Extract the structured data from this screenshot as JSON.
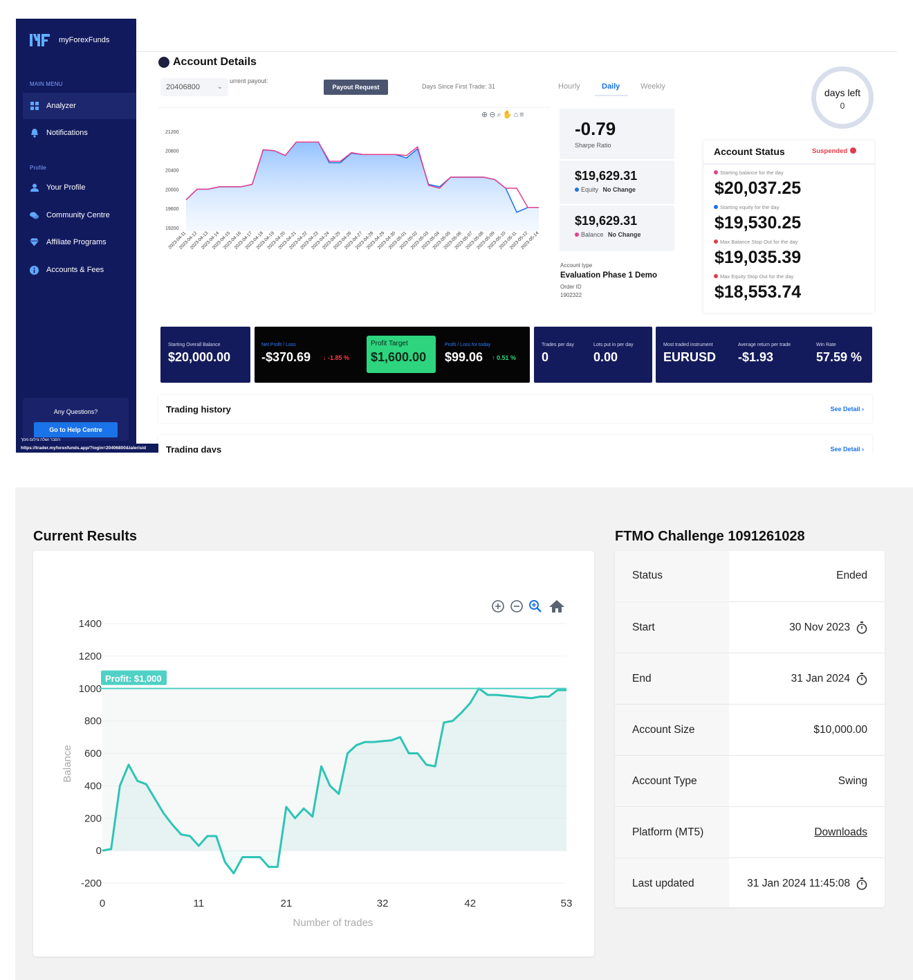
{
  "app": {
    "brand": "myForexFunds",
    "url": "https://trader.myforexfunds.app/?login=20406800&lalerisid"
  },
  "sidebar": {
    "main_menu_heading": "MAIN MENU",
    "profile_heading": "Profile",
    "items": [
      {
        "label": "Analyzer",
        "icon": "grid-icon",
        "active": true
      },
      {
        "label": "Notifications",
        "icon": "bell-icon"
      },
      {
        "label": "Your Profile",
        "icon": "user-icon"
      },
      {
        "label": "Community Centre",
        "icon": "chat-icon"
      },
      {
        "label": "Affiliate Programs",
        "icon": "diamond-icon"
      },
      {
        "label": "Accounts & Fees",
        "icon": "info-icon"
      }
    ],
    "help": {
      "question": "Any Questions?",
      "button": "Go to Help Centre",
      "hebrew": "הסבר ושלה צילום מסך"
    }
  },
  "account": {
    "title": "Account Details",
    "select_value": "20406800",
    "current_payout_label": "urrent payout:",
    "payout_button": "Payout Request",
    "days_since": "Days Since First Trade: 31",
    "tabs": [
      "Hourly",
      "Daily",
      "Weekly"
    ],
    "active_tab": "Daily",
    "days_left_label": "days left",
    "days_left_value": "0",
    "sharpe": {
      "value": "-0.79",
      "label": "Sharpe Ratio"
    },
    "equity": {
      "value": "$19,629.31",
      "label": "Equity",
      "change": "No Change",
      "color": "#1a73e8"
    },
    "balance": {
      "value": "$19,629.31",
      "label": "Balance",
      "change": "No Change",
      "color": "#e83e8c"
    },
    "account_type_label": "Account type",
    "account_type_value": "Evaluation Phase 1 Demo",
    "order_id_label": "Order ID",
    "order_id_value": "1902322"
  },
  "status": {
    "title": "Account Status",
    "badge": "Suspended",
    "items": [
      {
        "label": "Starting balance for the day",
        "value": "$20,037.25",
        "color": "#e83e8c"
      },
      {
        "label": "Starting equity for the day",
        "value": "$19,530.25",
        "color": "#1a73e8"
      },
      {
        "label": "Max Balance Stop Out for the day",
        "value": "$19,035.39",
        "color": "#e23c4b"
      },
      {
        "label": "Max Equity Stop Out for the day",
        "value": "$18,553.74",
        "color": "#e23c4b"
      }
    ]
  },
  "kpis": {
    "starting_balance": {
      "label": "Starting Overall Balance",
      "value": "$20,000.00"
    },
    "net_profit": {
      "label": "Net Profit / Loss",
      "value": "-$370.69",
      "pct": "↓ -1.85 %"
    },
    "profit_target": {
      "label": "Profit Target",
      "value": "$1,600.00"
    },
    "today": {
      "label": "Profit / Loss for today",
      "value": "$99.06",
      "pct": "↑ 0.51 %"
    },
    "trades_per_day": {
      "label": "Trades per day",
      "value": "0"
    },
    "lots_per_day": {
      "label": "Lots put in per day",
      "value": "0.00"
    },
    "instrument": {
      "label": "Most traded instrument",
      "value": "EURUSD"
    },
    "avg_return": {
      "label": "Average return per trade",
      "value": "-$1.93"
    },
    "win_rate": {
      "label": "Win Rate",
      "value": "57.59 %"
    }
  },
  "sections": [
    {
      "title": "Trading history",
      "link": "See Detail ›"
    },
    {
      "title": "Trading days",
      "link": "See Detail ›"
    }
  ],
  "ftmo": {
    "results_title": "Current Results",
    "challenge_title": "FTMO Challenge 1091261028",
    "rows": [
      {
        "key": "Status",
        "value": "Ended"
      },
      {
        "key": "Start",
        "value": "30 Nov 2023",
        "clock": true
      },
      {
        "key": "End",
        "value": "31 Jan 2024",
        "clock": true
      },
      {
        "key": "Account Size",
        "value": "$10,000.00"
      },
      {
        "key": "Account Type",
        "value": "Swing"
      },
      {
        "key": "Platform (MT5)",
        "value": "Downloads",
        "link": true
      },
      {
        "key": "Last updated",
        "value": "31 Jan 2024 11:45:08",
        "clock": true
      }
    ]
  },
  "chart_data": [
    {
      "type": "area",
      "categories": [
        "2023-04-11",
        "2023-04-12",
        "2023-04-13",
        "2023-04-14",
        "2023-04-15",
        "2023-04-16",
        "2023-04-17",
        "2023-04-18",
        "2023-04-19",
        "2023-04-20",
        "2023-04-21",
        "2023-04-22",
        "2023-04-23",
        "2023-04-24",
        "2023-04-25",
        "2023-04-26",
        "2023-04-27",
        "2023-04-28",
        "2023-04-29",
        "2023-04-30",
        "2023-05-01",
        "2023-05-02",
        "2023-05-03",
        "2023-05-04",
        "2023-05-05",
        "2023-05-06",
        "2023-05-07",
        "2023-05-08",
        "2023-05-09",
        "2023-05-10",
        "2023-05-11",
        "2023-05-12",
        "2023-05-14"
      ],
      "series": [
        {
          "name": "Equity",
          "color": "#1a73e8",
          "values": [
            19780,
            20000,
            20000,
            20050,
            20050,
            20050,
            20100,
            20820,
            20800,
            20700,
            20980,
            20980,
            20980,
            20550,
            20550,
            20750,
            20720,
            20720,
            20720,
            20720,
            20650,
            20840,
            20100,
            20050,
            20250,
            20250,
            20250,
            20250,
            20200,
            20020,
            19520,
            19620,
            19620
          ]
        },
        {
          "name": "Balance",
          "color": "#e83e8c",
          "values": [
            19780,
            20000,
            20000,
            20050,
            20050,
            20050,
            20100,
            20820,
            20800,
            20700,
            20980,
            20980,
            20980,
            20580,
            20580,
            20760,
            20720,
            20720,
            20720,
            20720,
            20700,
            20880,
            20080,
            20020,
            20250,
            20250,
            20250,
            20250,
            20200,
            20020,
            20020,
            19620,
            19620
          ]
        }
      ],
      "yticks": [
        21200,
        20800,
        20400,
        20000,
        19600,
        19200
      ],
      "ylim": [
        19200,
        21400
      ]
    },
    {
      "type": "area",
      "xlabel": "Number of trades",
      "ylabel": "Balance",
      "xticks": [
        0,
        11,
        21,
        32,
        42,
        53
      ],
      "yticks": [
        1400,
        1200,
        1000,
        800,
        600,
        400,
        200,
        0,
        -200
      ],
      "xlim": [
        0,
        53
      ],
      "ylim": [
        -200,
        1400
      ],
      "target_line": {
        "value": 1000,
        "label": "Profit: $1,000"
      },
      "series": [
        {
          "name": "Balance",
          "color": "#2ec4b6",
          "x": [
            0,
            1,
            2,
            3,
            4,
            5,
            6,
            7,
            8,
            9,
            10,
            11,
            12,
            13,
            14,
            15,
            16,
            17,
            18,
            19,
            20,
            21,
            22,
            23,
            24,
            25,
            26,
            27,
            28,
            29,
            30,
            31,
            32,
            33,
            34,
            35,
            36,
            37,
            38,
            39,
            40,
            41,
            42,
            43,
            44,
            45,
            46,
            47,
            48,
            49,
            50,
            51,
            52,
            53
          ],
          "values": [
            0,
            10,
            400,
            530,
            430,
            410,
            320,
            230,
            160,
            100,
            90,
            30,
            90,
            90,
            -70,
            -140,
            -40,
            -40,
            -40,
            -100,
            -100,
            270,
            200,
            260,
            210,
            520,
            400,
            350,
            600,
            650,
            670,
            670,
            675,
            680,
            700,
            600,
            600,
            530,
            520,
            790,
            800,
            850,
            910,
            1000,
            960,
            960,
            955,
            950,
            945,
            940,
            950,
            950,
            990,
            990
          ]
        }
      ]
    }
  ]
}
